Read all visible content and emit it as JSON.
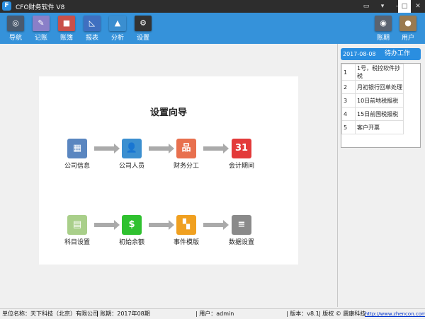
{
  "window": {
    "title": "CFO财务软件 V8",
    "logo": "F"
  },
  "toolbar": {
    "items": [
      {
        "label": "导航",
        "icon": "compass-icon",
        "color": "#4a5a6e"
      },
      {
        "label": "记账",
        "icon": "pencil-icon",
        "color": "#8a7fc8"
      },
      {
        "label": "账簿",
        "icon": "book-icon",
        "color": "#c9504a"
      },
      {
        "label": "报表",
        "icon": "report-icon",
        "color": "#3f6fc0"
      },
      {
        "label": "分析",
        "icon": "analysis-icon",
        "color": "#3a8ed0"
      },
      {
        "label": "设置",
        "icon": "gear-icon",
        "color": "#333333"
      }
    ],
    "right": [
      {
        "label": "账期",
        "icon": "clock-icon",
        "color": "#5a6370"
      },
      {
        "label": "用户",
        "icon": "user-icon",
        "color": "#9a7a50"
      }
    ]
  },
  "wizard": {
    "title": "设置向导",
    "row1": [
      {
        "label": "公司信息",
        "icon": "building-icon",
        "color": "#5a86c0",
        "glyph": "▦"
      },
      {
        "label": "公司人员",
        "icon": "person-icon",
        "color": "#3b8fd0",
        "glyph": "👤"
      },
      {
        "label": "财务分工",
        "icon": "org-chart-icon",
        "color": "#e8704e",
        "glyph": "品"
      },
      {
        "label": "会计期间",
        "icon": "calendar-icon",
        "color": "#e33a3a",
        "glyph": "31"
      }
    ],
    "row2": [
      {
        "label": "科目设置",
        "icon": "ledger-icon",
        "color": "#a9cf8a",
        "glyph": "▤"
      },
      {
        "label": "初始余额",
        "icon": "price-tag-icon",
        "color": "#2fc12f",
        "glyph": "$"
      },
      {
        "label": "事件模版",
        "icon": "blocks-icon",
        "color": "#f0a020",
        "glyph": "▚"
      },
      {
        "label": "数据设置",
        "icon": "database-icon",
        "color": "#8a8a8a",
        "glyph": "≡"
      }
    ]
  },
  "todo": {
    "date": "2017-08-08",
    "title": "待办工作",
    "items": [
      {
        "no": "1",
        "text": "1号，税控软件抄税"
      },
      {
        "no": "2",
        "text": "月初银行回单处理"
      },
      {
        "no": "3",
        "text": "10日前地税报税"
      },
      {
        "no": "4",
        "text": "15日前国税报税"
      },
      {
        "no": "5",
        "text": "客户开票"
      }
    ]
  },
  "status": {
    "company": "单位名称：天下科技（北京）有限公司",
    "period": "| 账期：2017年08期",
    "user": "| 用户：admin",
    "version": "| 版本：v8.1",
    "copyright": "| 版权 © 震康科技",
    "url": "http://www.zhencon.com"
  }
}
